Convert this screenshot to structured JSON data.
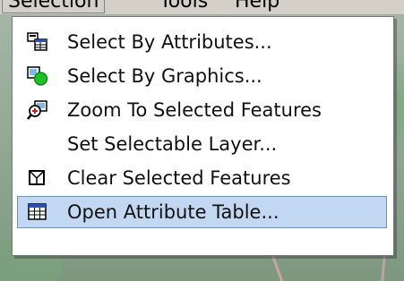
{
  "menubar": {
    "items": [
      {
        "label": "Selection"
      },
      {
        "label": "Tools"
      },
      {
        "label": "Help"
      }
    ]
  },
  "selection_menu": {
    "items": [
      {
        "label": "Select By Attributes...",
        "icon": "select-by-attributes-icon"
      },
      {
        "label": "Select By Graphics...",
        "icon": "select-by-graphics-icon"
      },
      {
        "label": "Zoom To Selected Features",
        "icon": "zoom-to-selected-icon"
      },
      {
        "label": "Set Selectable Layer...",
        "icon": ""
      },
      {
        "label": "Clear Selected Features",
        "icon": "clear-selection-icon"
      },
      {
        "label": "Open Attribute Table...",
        "icon": "attribute-table-icon",
        "highlighted": true
      }
    ]
  },
  "colors": {
    "highlight_fill": "#c2d7f2",
    "highlight_border": "#5f93d3",
    "menu_background": "#ffffff"
  }
}
